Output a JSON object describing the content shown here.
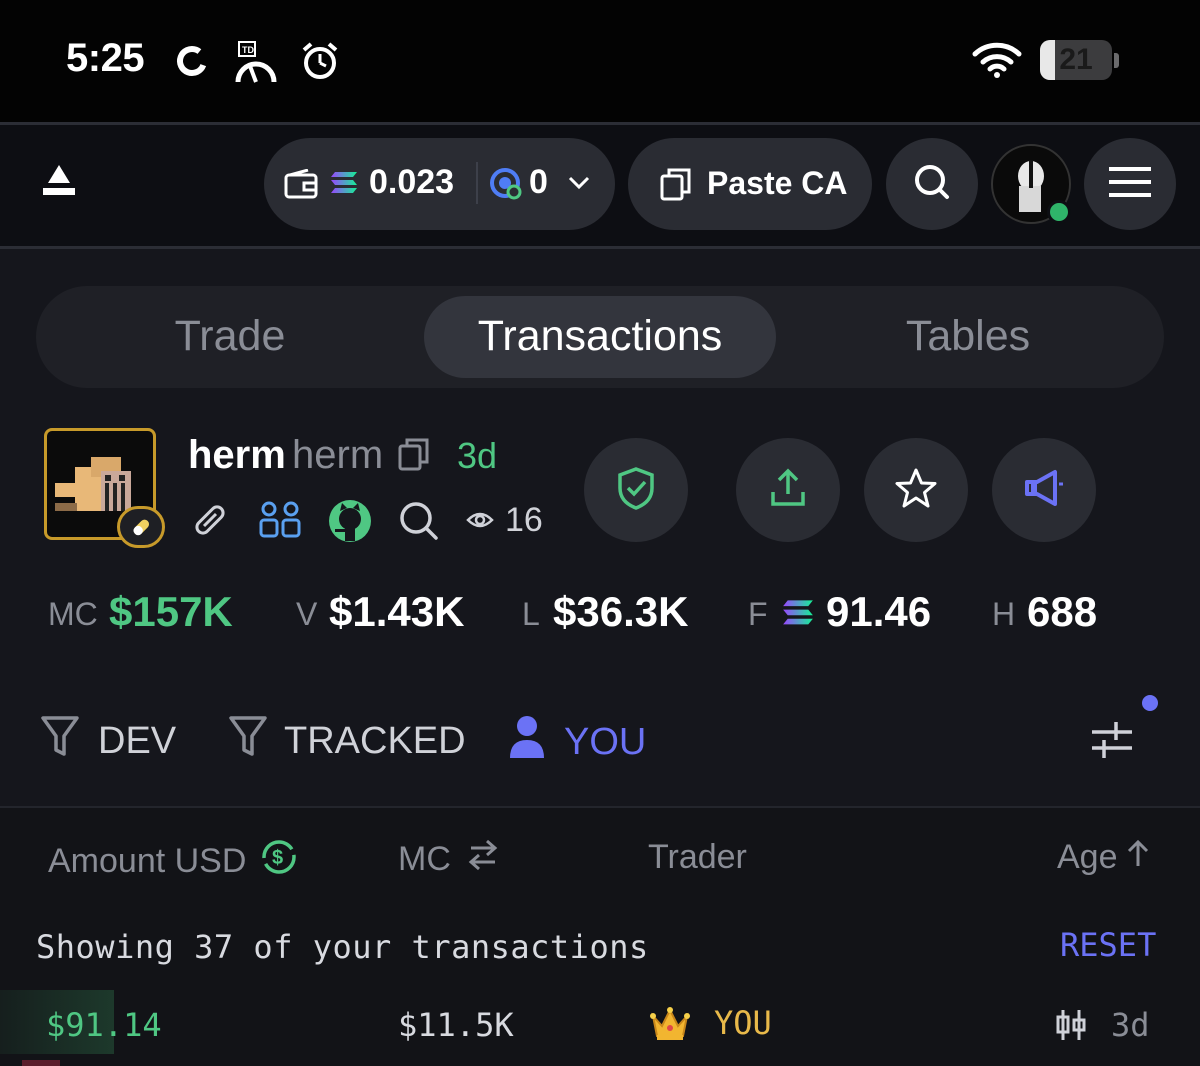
{
  "status_bar": {
    "time": "5:25",
    "battery": "21",
    "battery_level_percent": 21,
    "icons": [
      "sync-icon",
      "td-speedometer-icon",
      "alarm-clock-icon",
      "wifi-icon",
      "battery-icon"
    ]
  },
  "nav": {
    "wallet_amount": "0.023",
    "wallet_count": "0",
    "paste_label": "Paste CA",
    "icons": [
      "logo-icon",
      "wallet-icon",
      "solana-icon",
      "coin-icon",
      "chevron-down-icon",
      "copy-icon",
      "search-icon",
      "avatar",
      "menu-icon"
    ]
  },
  "tabs": [
    {
      "label": "Trade",
      "active": false
    },
    {
      "label": "Transactions",
      "active": true
    },
    {
      "label": "Tables",
      "active": false
    }
  ],
  "token": {
    "name": "herm",
    "ticker": "herm",
    "age": "3d",
    "watchers": "16",
    "link_icons": [
      "link-icon",
      "community-icon",
      "github-icon",
      "search-icon",
      "eye-icon"
    ],
    "action_icons": [
      "shield-check-icon",
      "share-icon",
      "star-icon",
      "megaphone-icon"
    ]
  },
  "stats": [
    {
      "label": "MC",
      "value": "$157K",
      "color": "#4fc783"
    },
    {
      "label": "V",
      "value": "$1.43K",
      "color": "#ffffff"
    },
    {
      "label": "L",
      "value": "$36.3K",
      "color": "#ffffff"
    },
    {
      "label": "F",
      "value": "91.46",
      "color": "#ffffff"
    },
    {
      "label": "H",
      "value": "688",
      "color": "#ffffff"
    }
  ],
  "filters": [
    {
      "label": "DEV"
    },
    {
      "label": "TRACKED"
    },
    {
      "label": "YOU",
      "active": true
    }
  ],
  "table": {
    "headers": [
      "Amount USD",
      "MC",
      "Trader",
      "Age"
    ],
    "showing_text": "Showing 37 of your transactions",
    "reset_label": "RESET",
    "rows": [
      {
        "amount": "$91.14",
        "mc": "$11.5K",
        "trader": "YOU",
        "age": "3d"
      }
    ]
  },
  "colors": {
    "accent_green": "#4fc783",
    "accent_blue": "#6b72f5",
    "gold": "#e8b94a",
    "background": "#15161c"
  }
}
